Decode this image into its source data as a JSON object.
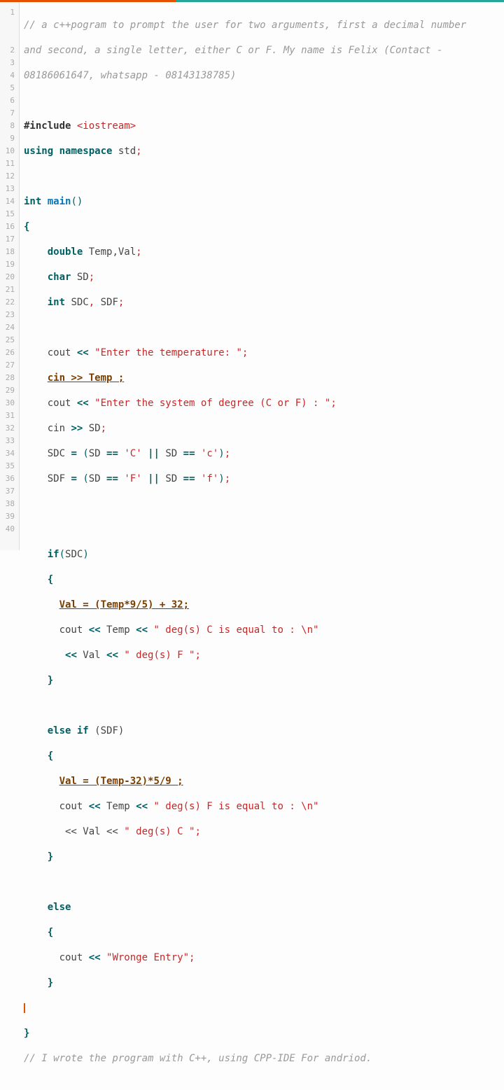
{
  "lines": [
    {
      "n": 1,
      "t": "cm",
      "txt": "// a c++pogram to prompt the user for two arguments, first a decimal number and second, a single letter, either C or F. My name is Felix (Contact - 08186061647, whatsapp - 08143138785)"
    },
    {
      "n": 2,
      "t": "blank",
      "txt": ""
    },
    {
      "n": 3,
      "t": "pp",
      "txt": "#include <iostream>"
    },
    {
      "n": 4,
      "t": "using",
      "txt": "using namespace std;"
    },
    {
      "n": 5,
      "t": "blank",
      "txt": ""
    },
    {
      "n": 6,
      "t": "main",
      "txt": "int main()"
    },
    {
      "n": 7,
      "t": "br",
      "txt": "{"
    },
    {
      "n": 8,
      "t": "decl",
      "txt": "    double Temp,Val;"
    },
    {
      "n": 9,
      "t": "decl",
      "txt": "    char SD;"
    },
    {
      "n": 10,
      "t": "decl",
      "txt": "    int SDC, SDF;"
    },
    {
      "n": 11,
      "t": "blank",
      "txt": ""
    },
    {
      "n": 12,
      "t": "cout",
      "txt": "    cout << \"Enter the temperature: \";"
    },
    {
      "n": 13,
      "t": "hl",
      "txt": "    cin >> Temp ;"
    },
    {
      "n": 14,
      "t": "cout",
      "txt": "    cout << \"Enter the system of degree (C or F) : \";"
    },
    {
      "n": 15,
      "t": "cin",
      "txt": "    cin >> SD;"
    },
    {
      "n": 16,
      "t": "assign",
      "txt": "    SDC = (SD == 'C' || SD == 'c');"
    },
    {
      "n": 17,
      "t": "assign",
      "txt": "    SDF = (SD == 'F' || SD == 'f');"
    },
    {
      "n": 18,
      "t": "blank",
      "txt": ""
    },
    {
      "n": 19,
      "t": "blank",
      "txt": ""
    },
    {
      "n": 20,
      "t": "if",
      "txt": "    if(SDC)"
    },
    {
      "n": 21,
      "t": "br",
      "txt": "    {"
    },
    {
      "n": 22,
      "t": "hl",
      "txt": "      Val = (Temp*9/5) + 32;"
    },
    {
      "n": 23,
      "t": "cout2",
      "txt": "      cout << Temp << \" deg(s) C is equal to : \\n\""
    },
    {
      "n": 24,
      "t": "cout3",
      "txt": "       << Val << \" deg(s) F \";"
    },
    {
      "n": 25,
      "t": "br",
      "txt": "    }"
    },
    {
      "n": 26,
      "t": "blank",
      "txt": ""
    },
    {
      "n": 27,
      "t": "elseif",
      "txt": "    else if (SDF)"
    },
    {
      "n": 28,
      "t": "br",
      "txt": "    {"
    },
    {
      "n": 29,
      "t": "hl",
      "txt": "      Val = (Temp-32)*5/9 ;"
    },
    {
      "n": 30,
      "t": "cout2",
      "txt": "      cout << Temp << \" deg(s) F is equal to : \\n\""
    },
    {
      "n": 31,
      "t": "cout3b",
      "txt": "       << Val << \" deg(s) C \";"
    },
    {
      "n": 32,
      "t": "br",
      "txt": "    }"
    },
    {
      "n": 33,
      "t": "blank",
      "txt": ""
    },
    {
      "n": 34,
      "t": "else",
      "txt": "    else"
    },
    {
      "n": 35,
      "t": "br",
      "txt": "    {"
    },
    {
      "n": 36,
      "t": "cout",
      "txt": "      cout << \"Wronge Entry\";"
    },
    {
      "n": 37,
      "t": "br",
      "txt": "    }"
    },
    {
      "n": 38,
      "t": "cursor",
      "txt": ""
    },
    {
      "n": 39,
      "t": "br",
      "txt": "}"
    },
    {
      "n": 40,
      "t": "cm",
      "txt": "// I wrote the program with C++, using CPP-IDE For andriod."
    }
  ],
  "strings": {
    "s12": "\"Enter the temperature: \"",
    "s14": "\"Enter the system of degree (C or F) : \"",
    "s23": "\" deg(s) C is equal to : \\n\"",
    "s24": "\" deg(s) F \"",
    "s30": "\" deg(s) F is equal to : \\n\"",
    "s31": "\" deg(s) C \"",
    "s36": "\"Wronge Entry\""
  }
}
